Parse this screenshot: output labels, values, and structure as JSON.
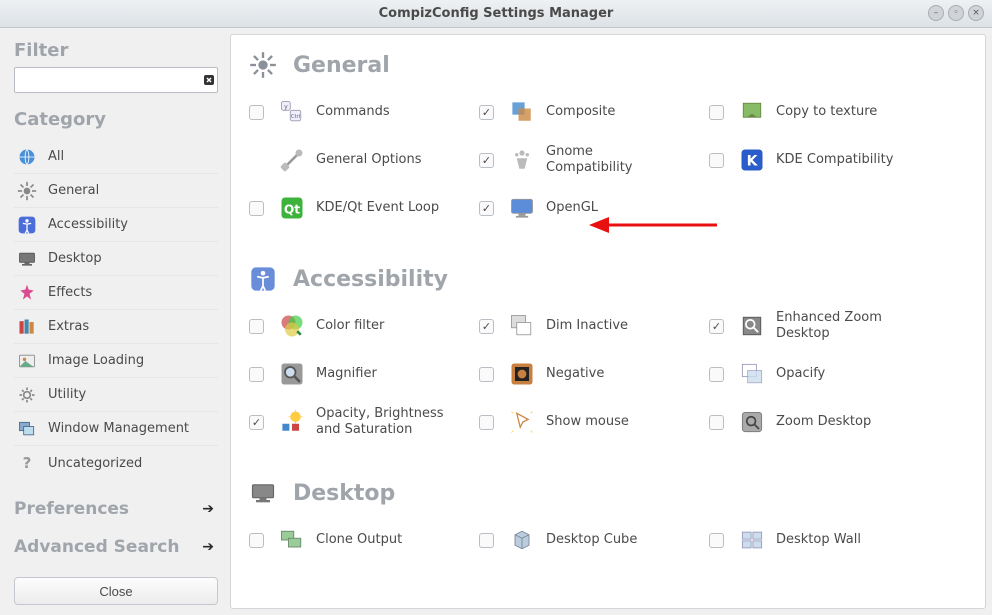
{
  "window": {
    "title": "CompizConfig Settings Manager"
  },
  "sidebar": {
    "filter_label": "Filter",
    "filter_value": "",
    "filter_placeholder": "",
    "category_label": "Category",
    "categories": [
      {
        "icon": "globe-icon",
        "label": "All"
      },
      {
        "icon": "gear-icon",
        "label": "General"
      },
      {
        "icon": "accessibility-icon",
        "label": "Accessibility"
      },
      {
        "icon": "desktop-icon",
        "label": "Desktop"
      },
      {
        "icon": "effects-icon",
        "label": "Effects"
      },
      {
        "icon": "extras-icon",
        "label": "Extras"
      },
      {
        "icon": "image-loading-icon",
        "label": "Image Loading"
      },
      {
        "icon": "utility-icon",
        "label": "Utility"
      },
      {
        "icon": "window-management-icon",
        "label": "Window Management"
      },
      {
        "icon": "uncategorized-icon",
        "label": "Uncategorized"
      }
    ],
    "preferences_label": "Preferences",
    "advanced_search_label": "Advanced Search",
    "close_label": "Close"
  },
  "content": {
    "sections": [
      {
        "id": "general",
        "title": "General",
        "icon": "gear-icon",
        "plugins": [
          {
            "checked": false,
            "icon": "commands-icon",
            "label": "Commands"
          },
          {
            "checked": true,
            "icon": "composite-icon",
            "label": "Composite"
          },
          {
            "checked": false,
            "icon": "copy-to-texture-icon",
            "label": "Copy to texture"
          },
          {
            "checked": null,
            "icon": "general-options-icon",
            "label": "General Options"
          },
          {
            "checked": true,
            "icon": "gnome-compat-icon",
            "label": "Gnome Compatibility"
          },
          {
            "checked": false,
            "icon": "kde-compat-icon",
            "label": "KDE Compatibility"
          },
          {
            "checked": false,
            "icon": "kde-qt-event-loop-icon",
            "label": "KDE/Qt Event Loop"
          },
          {
            "checked": true,
            "icon": "opengl-icon",
            "label": "OpenGL",
            "highlight": true
          }
        ]
      },
      {
        "id": "accessibility",
        "title": "Accessibility",
        "icon": "accessibility-icon",
        "plugins": [
          {
            "checked": false,
            "icon": "color-filter-icon",
            "label": "Color filter"
          },
          {
            "checked": true,
            "icon": "dim-inactive-icon",
            "label": "Dim Inactive"
          },
          {
            "checked": true,
            "icon": "enhanced-zoom-icon",
            "label": "Enhanced Zoom Desktop"
          },
          {
            "checked": false,
            "icon": "magnifier-icon",
            "label": "Magnifier"
          },
          {
            "checked": false,
            "icon": "negative-icon",
            "label": "Negative"
          },
          {
            "checked": false,
            "icon": "opacify-icon",
            "label": "Opacify"
          },
          {
            "checked": true,
            "icon": "opacity-brightness-icon",
            "label": "Opacity, Brightness and Saturation"
          },
          {
            "checked": false,
            "icon": "show-mouse-icon",
            "label": "Show mouse"
          },
          {
            "checked": false,
            "icon": "zoom-desktop-icon",
            "label": "Zoom Desktop"
          }
        ]
      },
      {
        "id": "desktop",
        "title": "Desktop",
        "icon": "desktop-icon",
        "plugins": [
          {
            "checked": false,
            "icon": "clone-output-icon",
            "label": "Clone Output"
          },
          {
            "checked": false,
            "icon": "desktop-cube-icon",
            "label": "Desktop Cube"
          },
          {
            "checked": false,
            "icon": "desktop-wall-icon",
            "label": "Desktop Wall"
          }
        ]
      }
    ]
  }
}
